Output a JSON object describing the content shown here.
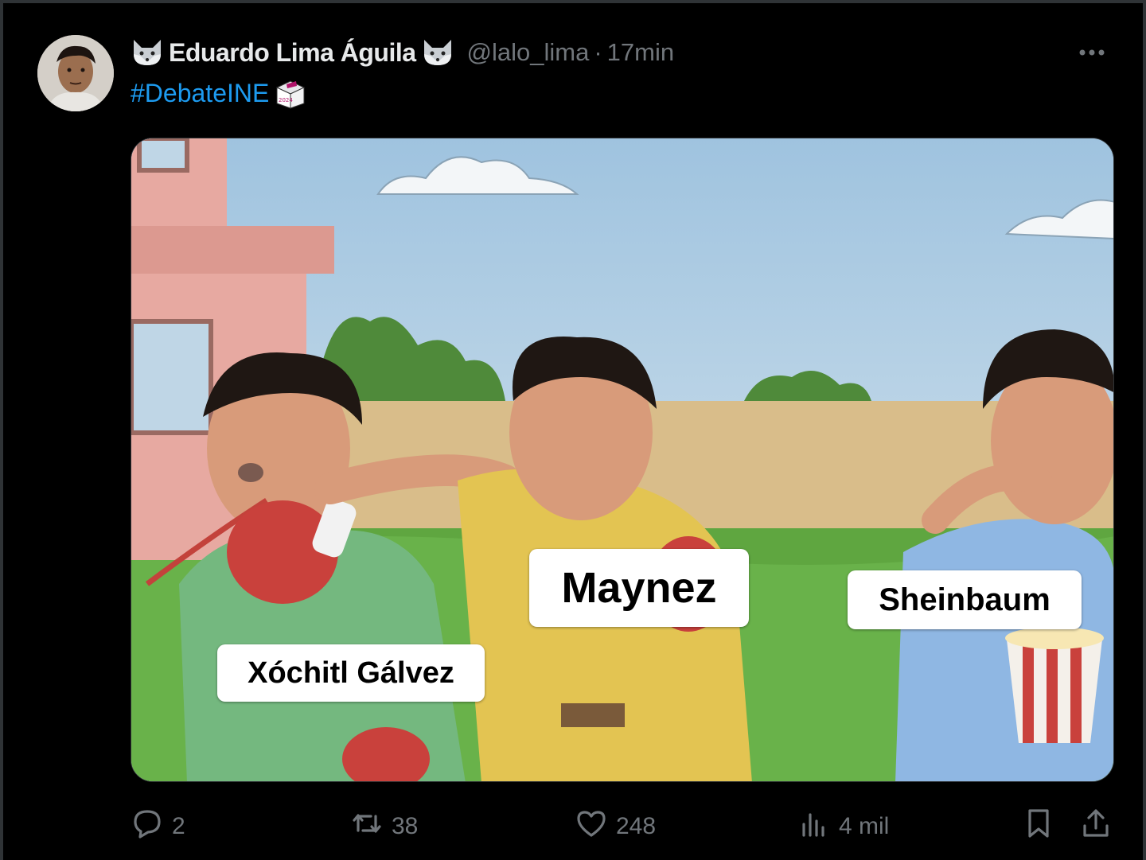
{
  "tweet": {
    "author_name": "Eduardo Lima Águila",
    "handle": "@lalo_lima",
    "separator": "·",
    "time": "17min",
    "hashtag": "#DebateINE",
    "ballot_emoji_text": "2024"
  },
  "meme": {
    "labels": {
      "left": "Xóchitl Gálvez",
      "center": "Maynez",
      "right": "Sheinbaum"
    }
  },
  "actions": {
    "replies": "2",
    "retweets": "38",
    "likes": "248",
    "views": "4 mil"
  },
  "icons": [
    "fox-emoji-icon",
    "ballot-box-icon",
    "more-icon",
    "reply-icon",
    "retweet-icon",
    "like-icon",
    "views-icon",
    "bookmark-icon",
    "share-icon"
  ],
  "colors": {
    "background": "#000000",
    "link": "#1d9bf0",
    "secondary_text": "#71767b",
    "primary_text": "#e7e9ea"
  }
}
